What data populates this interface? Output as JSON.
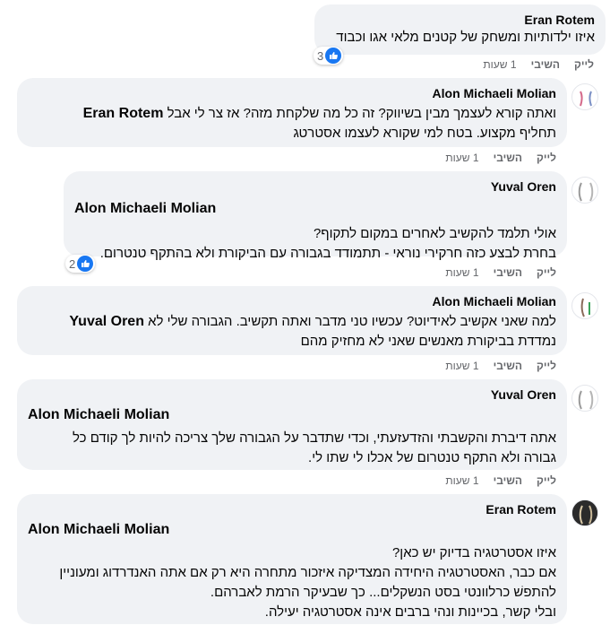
{
  "comments": [
    {
      "author": "Eran Rotem",
      "lines": [
        "איזו ילדותיות ומשחק של קטנים מלאי אגו וכבוד"
      ],
      "reactions": "3",
      "actions": {
        "like": "לייק",
        "reply": "השיבי",
        "time": "1 שעות"
      }
    },
    {
      "author": "Alon Michaeli Molian",
      "tagged": "Eran Rotem",
      "line1_rest": " ואתה קורא לעצמך מבין בשיווק? זה כל מה שלקחת מזה? אז צר לי אבל",
      "lines": [
        "תחליף מקצוע. בטח למי שקורא לעצמו אסטרטג"
      ],
      "actions": {
        "like": "לייק",
        "reply": "השיבי",
        "time": "1 שעות"
      }
    },
    {
      "author": "Yuval Oren",
      "tagged": "Alon Michaeli Molian",
      "lines": [
        "אולי תלמד להקשיב לאחרים במקום לתקוף?",
        "בחרת לבצע כזה חרקירי נוראי - תתמודד בגבורה עם הביקורת ולא בהתקף טנטרום."
      ],
      "reactions": "2",
      "actions": {
        "like": "לייק",
        "reply": "השיבי",
        "time": "1 שעות"
      }
    },
    {
      "author": "Alon Michaeli Molian",
      "tagged": "Yuval Oren",
      "line1_rest": "למה שאני אקשיב לאידיוט? עכשיו טני מדבר ואתה תקשיב. הגבורה שלי לא ",
      "lines": [
        "נמדדת בביקורת מאנשים שאני לא מחזיק מהם"
      ],
      "actions": {
        "like": "לייק",
        "reply": "השיבי",
        "time": "1 שעות"
      }
    },
    {
      "author": "Yuval Oren",
      "tagged": "Alon Michaeli Molian",
      "lines": [
        "אתה דיברת והקשבתי והזדעזעתי, וכדי שתדבר על הגבורה שלך צריכה להיות לך קודם כל",
        "גבורה ולא התקף טנטרום של אכלו לי שתו לי."
      ],
      "actions": {
        "like": "לייק",
        "reply": "השיבי",
        "time": "1 שעות"
      }
    },
    {
      "author": "Eran Rotem",
      "tagged": "Alon Michaeli Molian",
      "lines": [
        "איזו אסטרטגיה בדיוק יש כאן?",
        "אם כבר, האסטרטגיה היחידה המצדיקה איזכור מתחרה היא רק אם אתה האנדרדוג ומעוניין",
        "להתפשׁ כרלוונטי בסט הנשקלים... כך שבעיקר הרמת לאברהם.",
        "ובלי קשר, בכיינות ונהי ברבים אינה אסטרטגיה יעילה."
      ]
    }
  ],
  "colors": {
    "bubble": "#f0f2f5",
    "like_blue": "#1877f2",
    "meta_gray": "#65676b"
  },
  "icons": {
    "reaction": "thumbs-up-icon"
  }
}
